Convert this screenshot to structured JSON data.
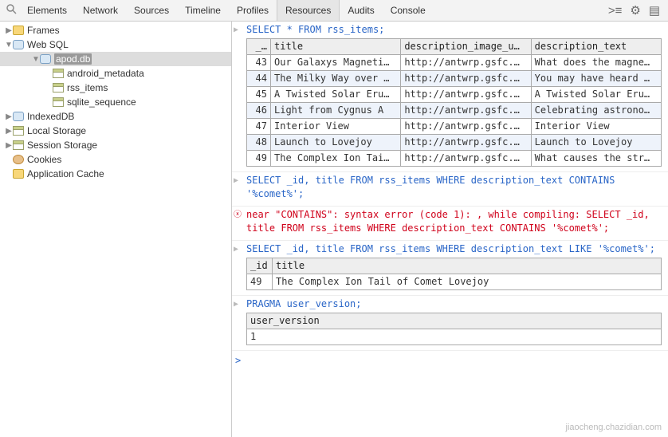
{
  "toolbar": {
    "tabs": [
      "Elements",
      "Network",
      "Sources",
      "Timeline",
      "Profiles",
      "Resources",
      "Audits",
      "Console"
    ],
    "active": "Resources"
  },
  "sidebar": {
    "frames": "Frames",
    "websql": "Web SQL",
    "db": "apod.db",
    "t1": "android_metadata",
    "t2": "rss_items",
    "t3": "sqlite_sequence",
    "indexeddb": "IndexedDB",
    "local": "Local Storage",
    "session": "Session Storage",
    "cookies": "Cookies",
    "appcache": "Application Cache"
  },
  "q1": {
    "sql": "SELECT * FROM rss_items;",
    "headers": [
      "_…",
      "title",
      "description_image_u…",
      "description_text"
    ],
    "rows": [
      {
        "id": "43",
        "title": "Our Galaxys Magneti…",
        "url": "http://antwrp.gsfc.…",
        "desc": "What does the magne…"
      },
      {
        "id": "44",
        "title": "The Milky Way over …",
        "url": "http://antwrp.gsfc.…",
        "desc": "You may have heard …"
      },
      {
        "id": "45",
        "title": "A Twisted Solar Eru…",
        "url": "http://antwrp.gsfc.…",
        "desc": "A Twisted Solar Eru…"
      },
      {
        "id": "46",
        "title": "Light from Cygnus A",
        "url": "http://antwrp.gsfc.…",
        "desc": "Celebrating astrono…"
      },
      {
        "id": "47",
        "title": "Interior View",
        "url": "http://antwrp.gsfc.…",
        "desc": "Interior View"
      },
      {
        "id": "48",
        "title": "Launch to Lovejoy",
        "url": "http://antwrp.gsfc.…",
        "desc": "Launch to Lovejoy"
      },
      {
        "id": "49",
        "title": "The Complex Ion Tai…",
        "url": "http://antwrp.gsfc.…",
        "desc": "What causes the str…"
      }
    ]
  },
  "q2": {
    "sql": "SELECT _id, title FROM rss_items WHERE description_text CONTAINS '%comet%';",
    "err": "near \"CONTAINS\": syntax error (code 1): , while compiling: SELECT _id, title FROM rss_items WHERE description_text CONTAINS '%comet%';"
  },
  "q3": {
    "sql": "SELECT _id, title FROM rss_items WHERE description_text LIKE '%comet%';",
    "headers": [
      "_id",
      "title"
    ],
    "row": {
      "id": "49",
      "title": "The Complex Ion Tail of Comet Lovejoy"
    }
  },
  "q4": {
    "sql": "PRAGMA user_version;",
    "header": "user_version",
    "value": "1"
  },
  "watermark": "jiaocheng.chazidian.com"
}
